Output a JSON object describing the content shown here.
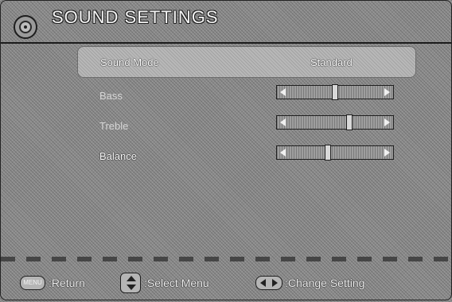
{
  "header": {
    "title": "SOUND SETTINGS",
    "icon": "speaker-disc-icon"
  },
  "menu": {
    "sound_mode": {
      "label": "Sound Mode",
      "value": "Standard"
    },
    "bass": {
      "label": "Bass",
      "level_percent": 50
    },
    "treble": {
      "label": "Treble",
      "level_percent": 62
    },
    "balance": {
      "label": "Balance",
      "level_percent": 44
    }
  },
  "footer": {
    "menu_key": "MENU",
    "return_label": ":Return",
    "select_label": ":Select Menu",
    "change_label": ":Change Setting",
    "icons": [
      "menu-button-icon",
      "up-down-arrows-icon",
      "left-right-arrows-icon"
    ]
  },
  "colors": {
    "background": "#8c8c8c",
    "selected_row": "#b8b8b8",
    "text_active": "#ffffff",
    "text_dim": "#d6d6d6"
  }
}
